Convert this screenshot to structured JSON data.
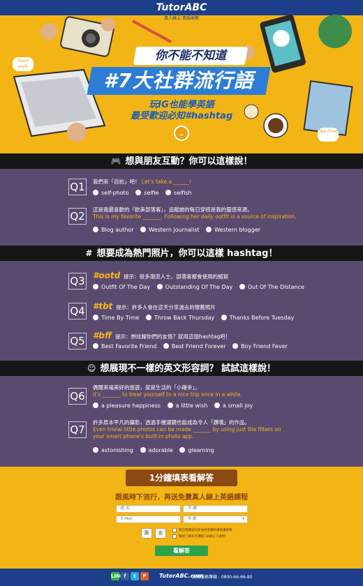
{
  "header": {
    "logo": "TutorABC",
    "logo_sub": "真人線上 英語家教",
    "title_small": "你不能不知道",
    "title_big": "#7大社群流行語",
    "subtitle_1": "玩IG也能學英語",
    "subtitle_2": "最受歡迎必知#hashtag",
    "tag_left": "Team work",
    "tag_right": "Tea Time"
  },
  "sections": [
    {
      "icon": "game-controller-icon",
      "title": "想與朋友互動？你可以這樣說！"
    },
    {
      "icon": "hashtag-icon",
      "title": "想要成為熱門照片，你可以這樣 hashtag！"
    },
    {
      "icon": "smiley-icon",
      "title": "想展現不一樣的英文形容詞？ 試試這樣說！"
    }
  ],
  "questions": {
    "q1": {
      "num": "Q1",
      "zh": "我們來「自拍」吧！",
      "en": "Let's take a ______！",
      "options": [
        "self-photo",
        "selfie",
        "selfish"
      ]
    },
    "q2": {
      "num": "Q2",
      "zh": "這是我最喜歡的「歐美部落客」，追蹤她的每日穿搭是我的靈感來源。",
      "en": "This is my favorite _______. Following her daily outfit is a source of inspiration.",
      "options": [
        "Blog author",
        "Western journalist",
        "Western blogger"
      ]
    },
    "q3": {
      "num": "Q3",
      "tag": "#ootd",
      "hint": "提示：很多潮流人士、部落客都會使用的縮寫",
      "options": [
        "Outfit Of The Day",
        "Outstanding Of The Day",
        "Out Of The Distance"
      ]
    },
    "q4": {
      "num": "Q4",
      "tag": "#tbt",
      "hint": "提示：許多人會在這天分享過去的懷舊照片",
      "options": [
        "Time By Time",
        "Throw Back Thursday",
        "Thanks Before Tuesday"
      ]
    },
    "q5": {
      "num": "Q5",
      "tag": "#bff",
      "hint": "提示：想炫耀你們的友情？就用這個hashtag吧！",
      "options": [
        "Best Favorite Friend",
        "Best Friend Forever",
        "Boy Friend Fever"
      ]
    },
    "q6": {
      "num": "Q6",
      "zh": "偶爾來場美好的旅遊，就是生活的「小確幸」。",
      "en": "It's _______ to treat yourself to a nice trip once in a while.",
      "options": [
        "a pleasure happiness",
        "a little wish",
        "a small joy"
      ]
    },
    "q7": {
      "num": "Q7",
      "zh": "許多原本平凡的攝影，透過手機濾鏡也能成為令人「讚嘆」的作品。",
      "en1": "Even trivial little photos can be made _______ by using just the filters on",
      "en2": "your smart phone's built-in photo app.",
      "options": [
        "astonishing",
        "adorable",
        "gleaming"
      ]
    }
  },
  "form": {
    "title": "1分鐘填表看解答",
    "subtitle": "跟風時下流行，再送免費真人線上英語課程",
    "name_ph": "姓 名",
    "phone_ph": "手 機",
    "email_ph": "E-Mail",
    "age_ph": "年 齡",
    "male": "男",
    "female": "女",
    "agree_1": "我已閱讀並同意並接受隱私權保護政策",
    "agree_2": "我想了解孩子課程(18歲以下適用)",
    "submit": "看解答"
  },
  "footer": {
    "social": [
      "LINE",
      "f",
      "t",
      "P"
    ],
    "logo": "TutorABC.com",
    "phone": "免費服務專線 : 0800-66-66-80"
  },
  "colors": {
    "accent_yellow": "#f2b515",
    "purple_bg": "#5b4a70",
    "brand_blue": "#1d3f8a",
    "answer_yellow": "#f5b718",
    "submit_green": "#2ea14b"
  }
}
